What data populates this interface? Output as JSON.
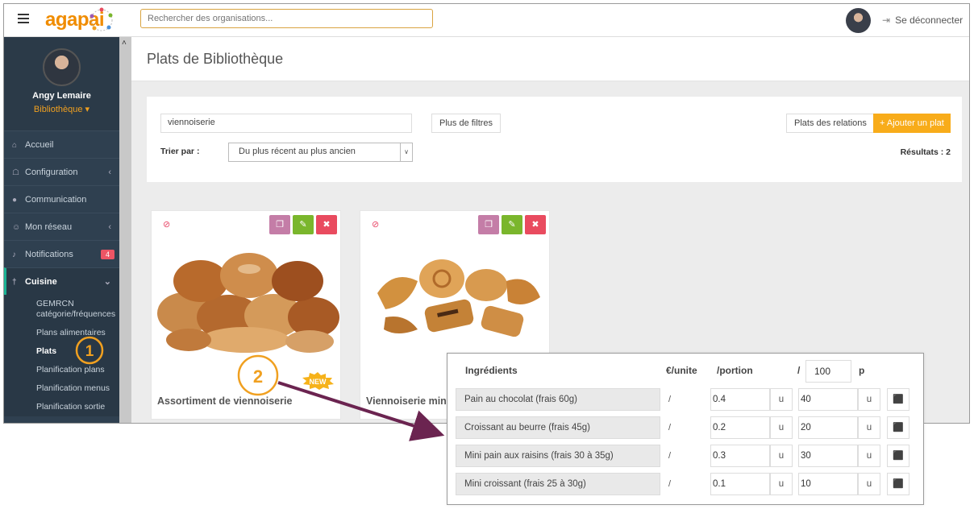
{
  "topbar": {
    "logo": "agapai",
    "search_placeholder": "Rechercher des organisations...",
    "logout": "Se déconnecter"
  },
  "sidebar": {
    "user_name": "Angy Lemaire",
    "user_role": "Bibliothèque ▾",
    "items": [
      {
        "label": "Accueil",
        "icon": "home-icon"
      },
      {
        "label": "Configuration",
        "icon": "bank-icon"
      },
      {
        "label": "Communication",
        "icon": "chat-icon"
      },
      {
        "label": "Mon réseau",
        "icon": "users-icon"
      },
      {
        "label": "Notifications",
        "icon": "bell-icon",
        "badge": "4"
      },
      {
        "label": "Cuisine",
        "icon": "cutlery-icon"
      }
    ],
    "submenu": [
      "GEMRCN catégorie/fréquences",
      "Plans alimentaires",
      "Plats",
      "Planification plans",
      "Planification menus",
      "Planification sortie"
    ]
  },
  "page": {
    "title": "Plats de Bibliothèque"
  },
  "filters": {
    "search_value": "viennoiserie",
    "more_filters": "Plus de filtres",
    "sort_label": "Trier par :",
    "sort_value": "Du plus récent au plus ancien",
    "relations_button": "Plats des relations",
    "add_button": "+ Ajouter un plat",
    "results": "Résultats : 2"
  },
  "cards": [
    {
      "title": "Assortiment de viennoiserie",
      "badge": "NEW"
    },
    {
      "title": "Viennoiserie mini"
    }
  ],
  "callouts": [
    "1",
    "2"
  ],
  "ingredients": {
    "header": "Ingrédients",
    "col_price": "€/unite",
    "col_portion": "/portion",
    "col_slash": "/",
    "portions": "100",
    "col_p": "p",
    "rows": [
      {
        "name": "Pain au chocolat (frais 60g)",
        "price": "/",
        "qty": "0.4",
        "unit": "u",
        "qty100": "40",
        "unit100": "u"
      },
      {
        "name": "Croissant au beurre (frais 45g)",
        "price": "/",
        "qty": "0.2",
        "unit": "u",
        "qty100": "20",
        "unit100": "u"
      },
      {
        "name": "Mini pain aux raisins (frais 30 à 35g)",
        "price": "/",
        "qty": "0.3",
        "unit": "u",
        "qty100": "30",
        "unit100": "u"
      },
      {
        "name": "Mini croissant (frais 25 à 30g)",
        "price": "/",
        "qty": "0.1",
        "unit": "u",
        "qty100": "10",
        "unit100": "u"
      }
    ]
  },
  "colors": {
    "brand": "#f08c00",
    "sidebar": "#2f4050",
    "callout": "#f0a020",
    "arrow": "#6b2450"
  }
}
